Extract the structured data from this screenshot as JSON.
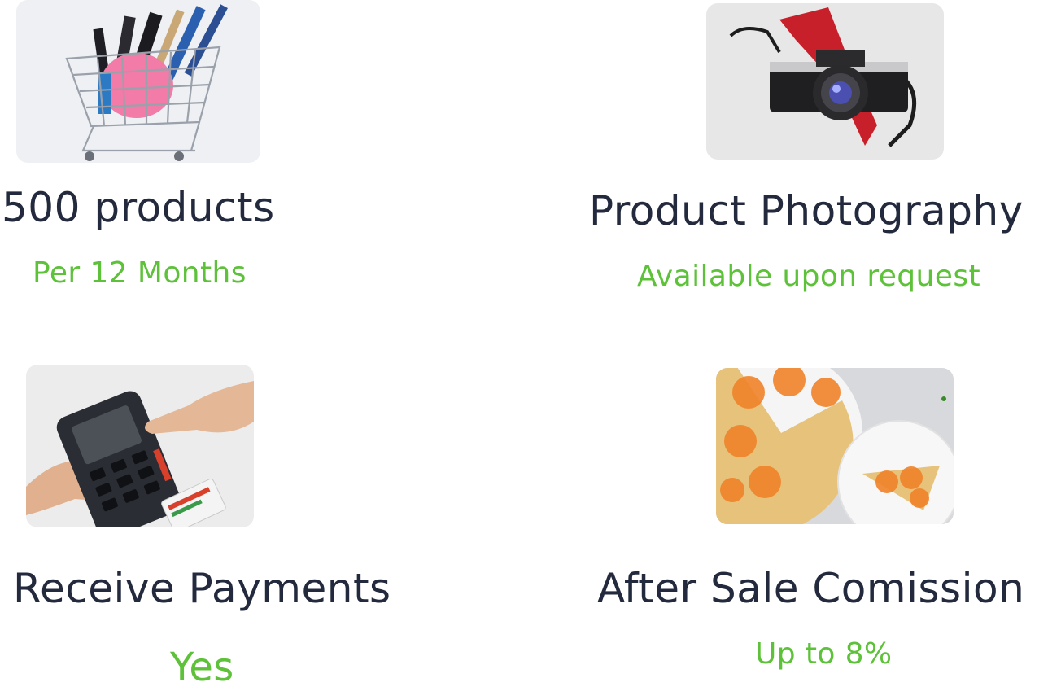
{
  "features": [
    {
      "title": "500 products",
      "subtitle": "Per 12 Months",
      "image": "shopping-cart-cosmetics"
    },
    {
      "title": "Product Photography",
      "subtitle": "Available upon request",
      "image": "camera"
    },
    {
      "title": "Receive Payments",
      "subtitle": "Yes",
      "image": "card-terminal"
    },
    {
      "title": "After Sale Comission",
      "subtitle": "Up to 8%",
      "image": "orange-tart"
    }
  ],
  "colors": {
    "title": "#232a3d",
    "accent": "#5ec13a",
    "background": "#ffffff"
  }
}
